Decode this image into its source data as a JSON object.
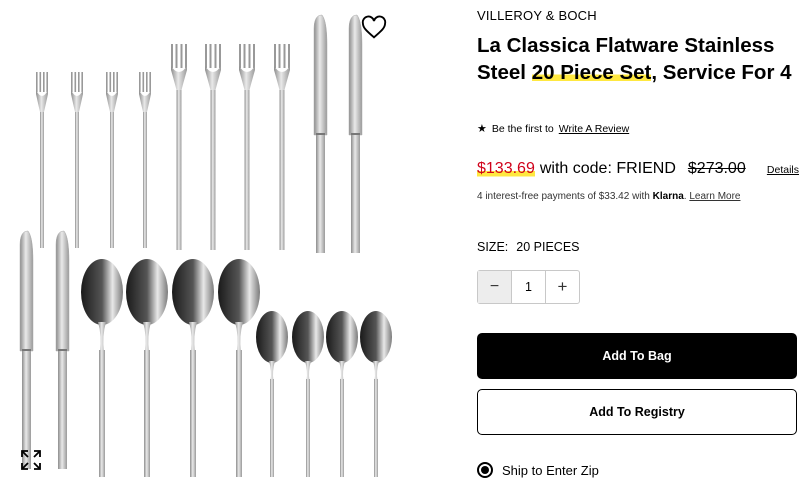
{
  "product": {
    "brand": "VILLEROY & BOCH",
    "title_before": "La Classica Flatware Stainless Steel ",
    "title_highlight": "20 Piece Set",
    "title_after": ", Service For 4"
  },
  "review": {
    "prefix": "Be the first to",
    "link": "Write A Review"
  },
  "price": {
    "sale": "$133.69",
    "code_text": "with code: FRIEND",
    "original": "$273.00",
    "details_link": "Details"
  },
  "klarna": {
    "text": "4 interest-free payments of $33.42 with",
    "brand": "Klarna",
    "link": "Learn More"
  },
  "size": {
    "label": "SIZE:",
    "value": "20 PIECES"
  },
  "quantity": {
    "value": "1",
    "minus": "−",
    "plus": "+"
  },
  "buttons": {
    "add_to_bag": "Add To Bag",
    "add_to_registry": "Add To Registry"
  },
  "shipping": {
    "option": "Ship to Enter Zip",
    "selected": true
  },
  "icons": {
    "wishlist": "heart-icon",
    "expand": "expand-icon",
    "star": "star-icon"
  },
  "colors": {
    "sale": "#d0021b",
    "highlight": "#ffe840",
    "primary_button": "#000000"
  }
}
